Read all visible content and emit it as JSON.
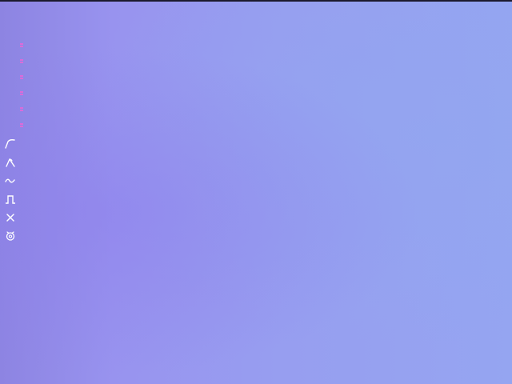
{
  "colors": {
    "background_left": "#8d84e2",
    "background_right": "#95a5f1",
    "top_bar": "#1c1a2e",
    "marker": "#e26ad9",
    "tool_icon": "#ffffff"
  },
  "markers": [
    {
      "icon": "pink-tick-icon"
    },
    {
      "icon": "pink-tick-icon"
    },
    {
      "icon": "pink-tick-icon"
    },
    {
      "icon": "pink-tick-icon"
    },
    {
      "icon": "pink-tick-icon"
    },
    {
      "icon": "pink-tick-icon"
    }
  ],
  "toolbar": {
    "items": [
      {
        "icon": "ramp-curve-icon"
      },
      {
        "icon": "peak-curve-icon"
      },
      {
        "icon": "sine-wave-icon"
      },
      {
        "icon": "square-pulse-icon"
      },
      {
        "icon": "close-icon"
      },
      {
        "icon": "settings-icon"
      }
    ]
  }
}
